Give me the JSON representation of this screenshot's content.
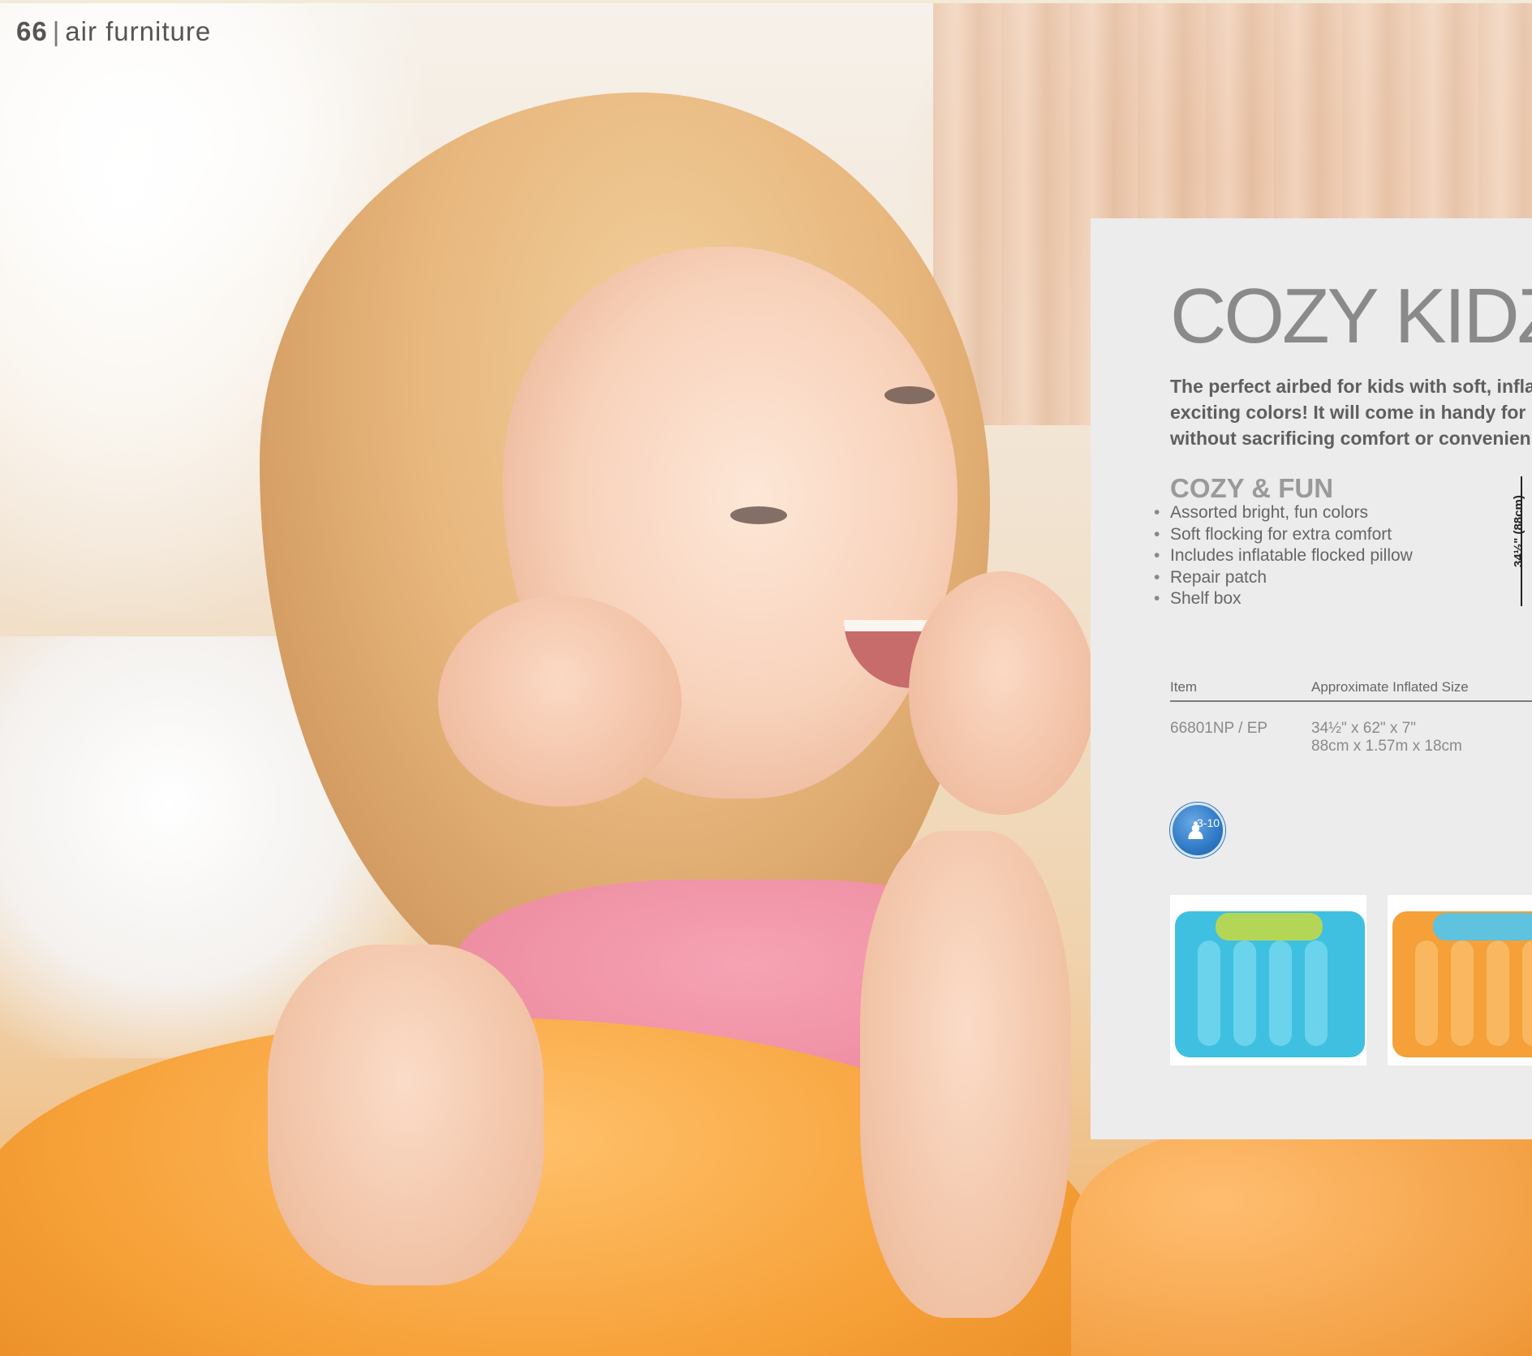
{
  "header": {
    "page_number": "66",
    "separator": "|",
    "section": "air furniture"
  },
  "product": {
    "title": "COZY KIDZ",
    "description_lines": [
      "The perfect airbed for kids with soft, infla",
      "exciting colors! It will come in handy for",
      "without sacrificing comfort or convenien"
    ],
    "features_heading": "COZY & FUN",
    "features": [
      "Assorted bright, fun colors",
      "Soft flocking for extra comfort",
      "Includes inflatable flocked pillow",
      "Repair patch",
      "Shelf box"
    ],
    "dimension_label": "34½\" (88cm)",
    "table": {
      "headers": [
        "Item",
        "Approximate Inflated Size"
      ],
      "rows": [
        {
          "item": "66801NP / EP",
          "size_in": "34½\" x 62\" x 7\"",
          "size_metric": "88cm x 1.57m x 18cm"
        }
      ]
    },
    "age_badge": "3-10",
    "variants": [
      {
        "name": "blue",
        "color": "#3fc0e0",
        "pillow_color": "#b4d657"
      },
      {
        "name": "orange",
        "color": "#f5a038",
        "pillow_color": "#5fc2de"
      }
    ]
  }
}
